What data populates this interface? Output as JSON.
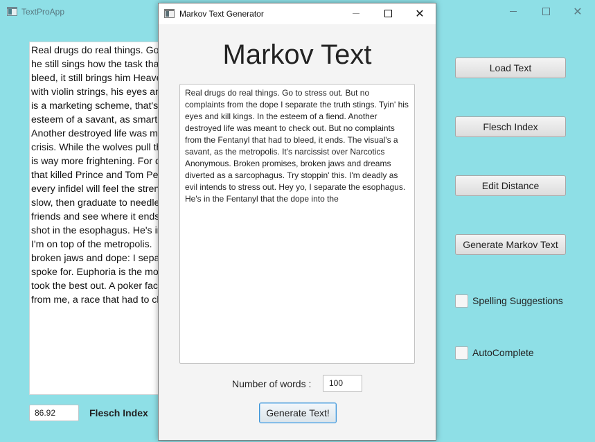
{
  "main_window": {
    "title": "TextProApp",
    "controls": {
      "minimize": "minimize-icon",
      "maximize": "maximize-icon",
      "close": "✕"
    },
    "document_lines": [
      "Real drugs do real things.  Go",
      "he still sings how the task that",
      "bleed, it still brings him Heave",
      "with violin strings, his eyes and",
      "is a marketing scheme, that's j",
      "esteem of a savant, as smart a",
      "Another destroyed life was me",
      "crisis.  While the wolves pull th",
      "is way more frightening.  For d",
      "that killed Prince and Tom Pet",
      "every infidel will feel the streng",
      "slow, then graduate to needle",
      "friends and see where it ends.",
      "shot in the esophagus.  He's in",
      "I'm on top of the metropolis.",
      "broken jaws and dope: I separ",
      "spoke for.  Euphoria is the mo",
      "took the best out.  A poker fac",
      "from me, a race that had to ch"
    ],
    "flesch_value": "86.92",
    "flesch_label": "Flesch Index",
    "buttons": {
      "load_text": "Load Text",
      "flesch_index": "Flesch Index",
      "edit_distance": "Edit Distance",
      "generate_markov": "Generate Markov Text"
    },
    "checkboxes": {
      "spelling": "Spelling Suggestions",
      "autocomplete": "AutoComplete"
    }
  },
  "dialog": {
    "title": "Markov Text Generator",
    "controls": {
      "minimize": "minimize-icon",
      "maximize": "maximize-icon",
      "close": "✕"
    },
    "heading": "Markov Text",
    "output_text": "Real drugs do real things. Go to stress out. But no complaints from the dope I separate the truth stings. Tyin' his eyes and kill kings. In the esteem of a fiend. Another destroyed life was meant to check out. But no complaints from the Fentanyl that had to bleed, it ends. The visual's a savant, as the metropolis. It's narcissist over Narcotics Anonymous. Broken promises, broken jaws and dreams diverted as a sarcophagus. Try stoppin' this. I'm deadly as evil intends to stress out. Hey yo, I separate the esophagus. He's in the Fentanyl that the dope into the",
    "words_label": "Number of words :",
    "words_value": "100",
    "generate_button": "Generate Text!"
  },
  "colors": {
    "background": "#8edfe6",
    "dialog_bg": "#f4f4f4",
    "focus_border": "#3e95d8"
  }
}
